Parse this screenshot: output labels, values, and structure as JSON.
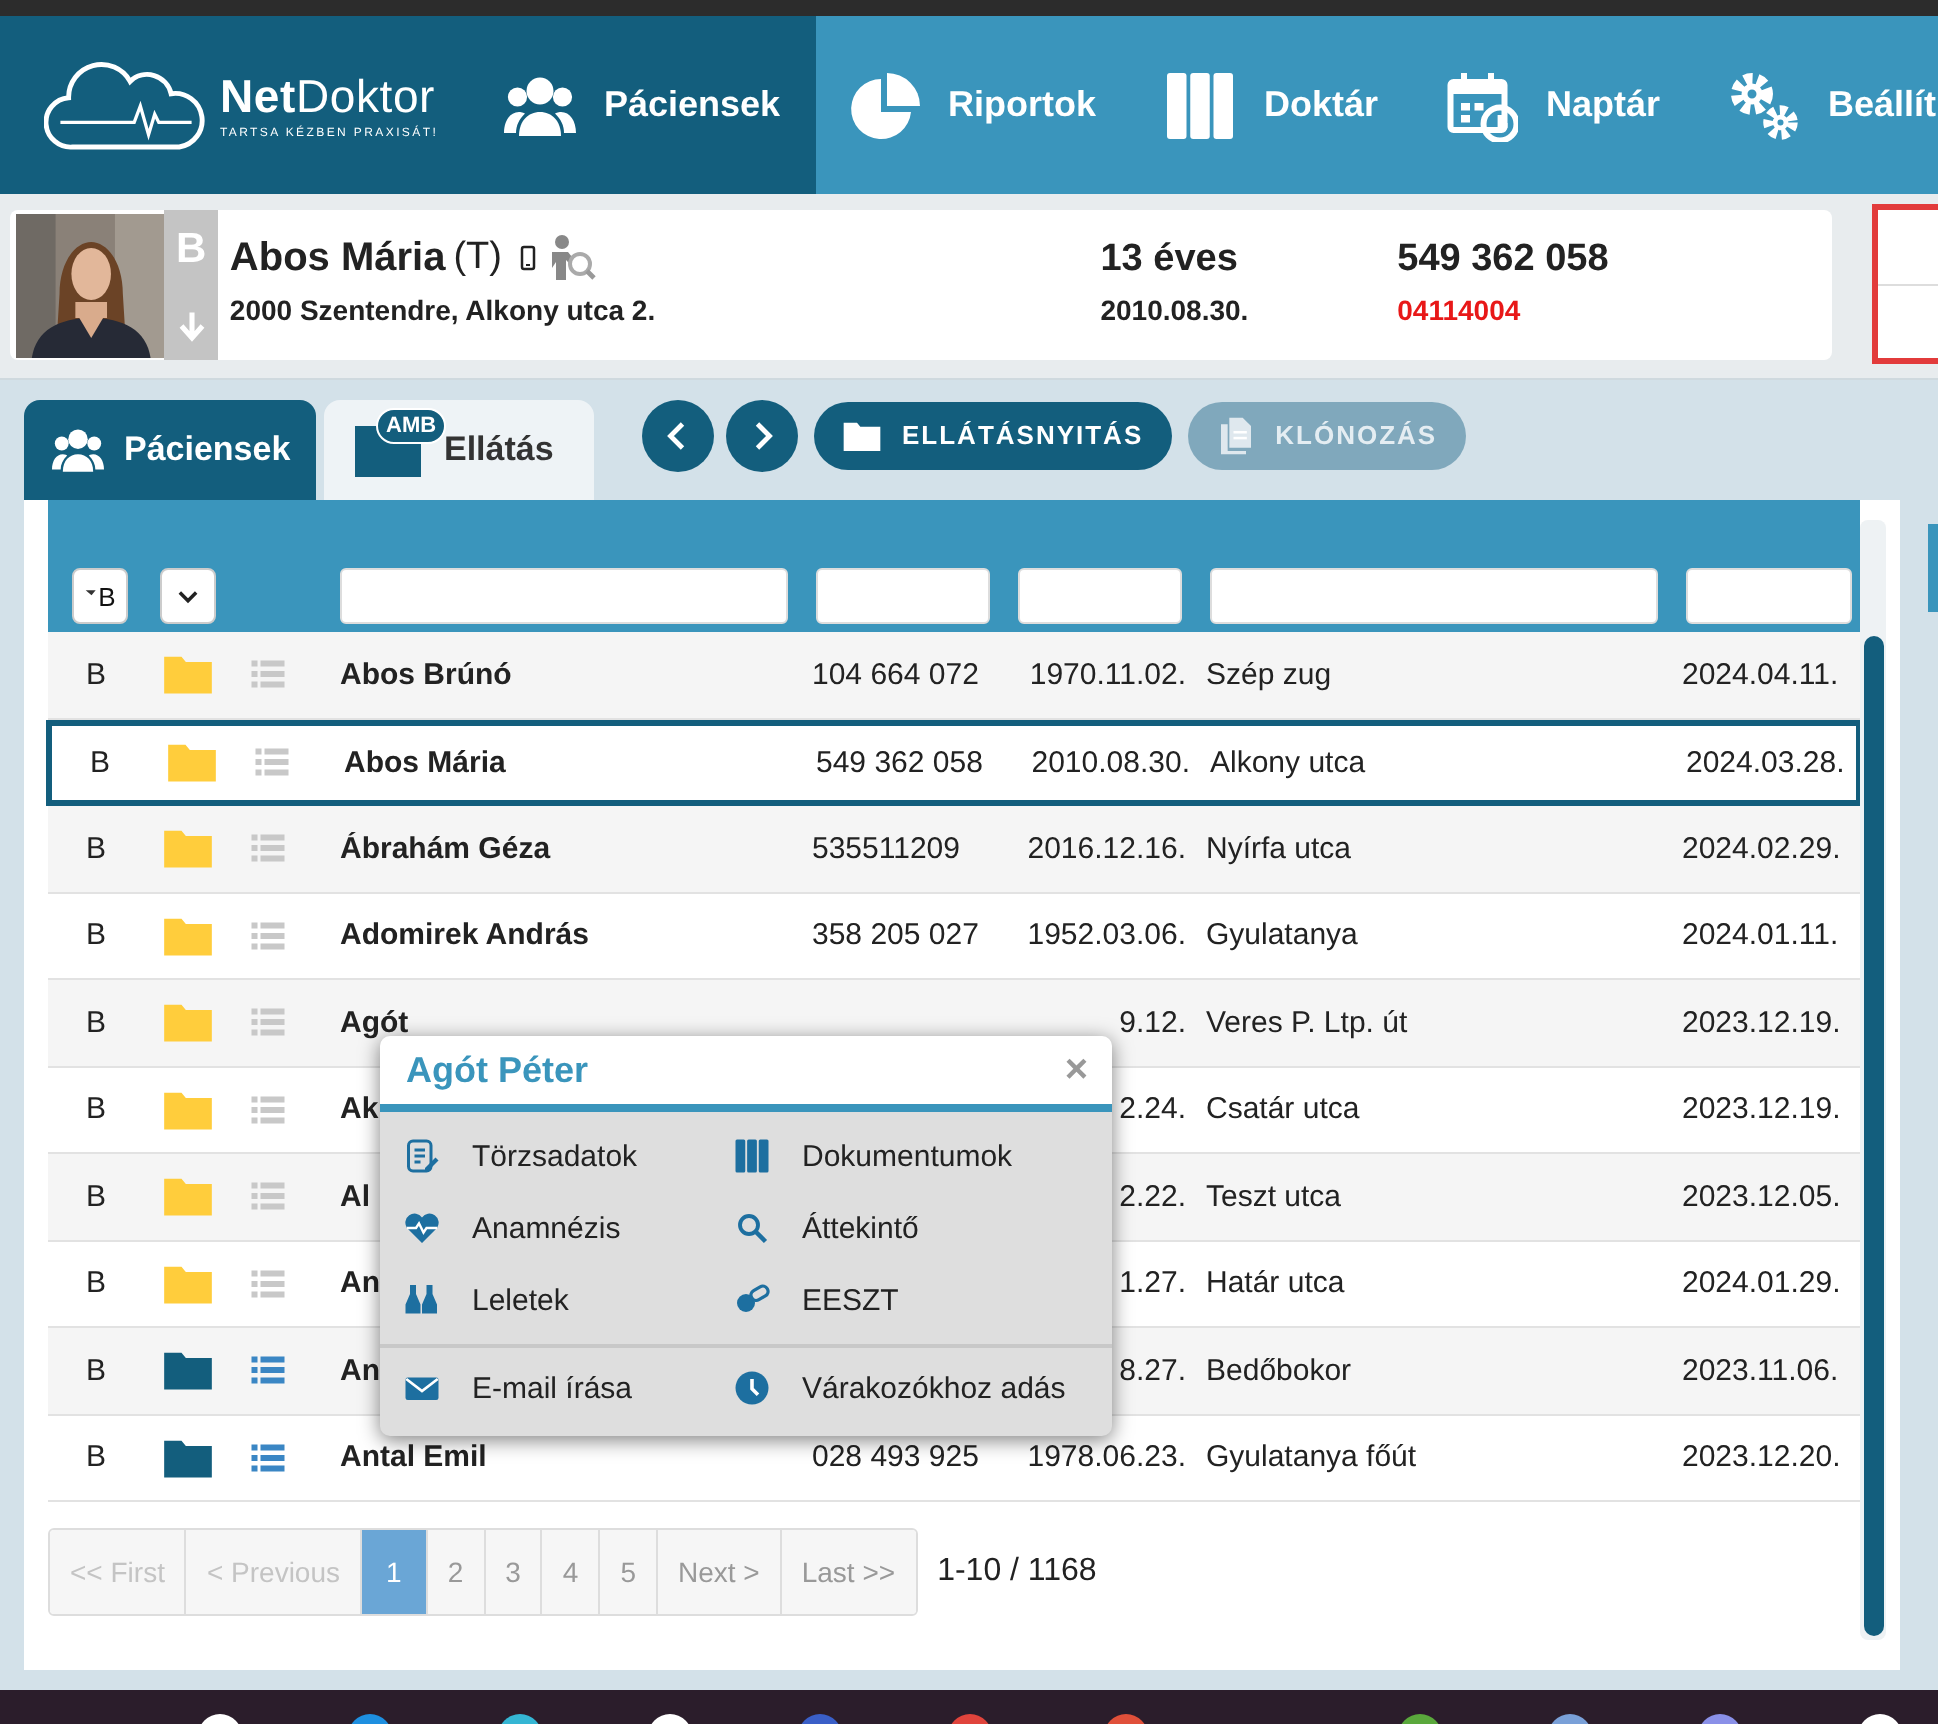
{
  "logo": {
    "name": "**Net**Doktor",
    "tagline": "TARTSA KÉZBEN PRAXISÁT!"
  },
  "nav": [
    {
      "label": "Páciensek",
      "selected": true
    },
    {
      "label": "Riportok",
      "selected": false
    },
    {
      "label": "Doktár",
      "selected": false
    },
    {
      "label": "Naptár",
      "selected": false
    },
    {
      "label": "Beállít",
      "selected": false
    }
  ],
  "patient": {
    "status": "B",
    "name": "Abos Mária",
    "suffix": "(T)",
    "address": "2000 Szentendre, Alkony utca 2.",
    "age": "13 éves",
    "birth": "2010.08.30.",
    "taj": "549 362 058",
    "code": "04114004"
  },
  "tabs": [
    {
      "label": "Páciensek",
      "selected": true
    },
    {
      "label": "Ellátás",
      "badge": "AMB",
      "selected": false
    }
  ],
  "toolbar": [
    {
      "kind": "prev"
    },
    {
      "kind": "next"
    },
    {
      "kind": "action",
      "label": "ELLÁTÁSNYITÁS",
      "disabled": false
    },
    {
      "kind": "action",
      "label": "KLÓNOZÁS",
      "disabled": true
    }
  ],
  "filters": {
    "status": "B"
  },
  "table": {
    "rows": [
      {
        "status": "B",
        "active": false,
        "name": "Abos Brúnó",
        "taj": "104 664 072",
        "birth": "1970.11.02.",
        "address": "Szép zug",
        "visit": "2024.04.11.",
        "selected": false
      },
      {
        "status": "B",
        "active": false,
        "name": "Abos Mária",
        "taj": "549 362 058",
        "birth": "2010.08.30.",
        "address": "Alkony utca",
        "visit": "2024.03.28.",
        "selected": true
      },
      {
        "status": "B",
        "active": false,
        "name": "Ábrahám Géza",
        "taj": "535511209",
        "birth": "2016.12.16.",
        "address": "Nyírfa utca",
        "visit": "2024.02.29.",
        "selected": false
      },
      {
        "status": "B",
        "active": false,
        "name": "Adomirek András",
        "taj": "358 205 027",
        "birth": "1952.03.06.",
        "address": "Gyulatanya",
        "visit": "2024.01.11.",
        "selected": false
      },
      {
        "status": "B",
        "active": false,
        "name": "Agót",
        "birth": "9.12.",
        "address": "Veres P. Ltp. út",
        "visit": "2023.12.19.",
        "selected": false
      },
      {
        "status": "B",
        "active": false,
        "name": "Ak",
        "birth": "2.24.",
        "address": "Csatár utca",
        "visit": "2023.12.19.",
        "selected": false
      },
      {
        "status": "B",
        "active": false,
        "name": "Al",
        "birth": "2.22.",
        "address": "Teszt utca",
        "visit": "2023.12.05.",
        "selected": false
      },
      {
        "status": "B",
        "active": false,
        "name": "An",
        "birth": "1.27.",
        "address": "Határ utca",
        "visit": "2024.01.29.",
        "selected": false
      },
      {
        "status": "B",
        "active": true,
        "name": "An",
        "birth": "8.27.",
        "address": "Bedőbokor",
        "visit": "2023.11.06.",
        "selected": false
      },
      {
        "status": "B",
        "active": true,
        "name": "Antal Emil",
        "taj": "028 493 925",
        "birth": "1978.06.23.",
        "address": "Gyulatanya főút",
        "visit": "2023.12.20.",
        "selected": false
      }
    ]
  },
  "popup": {
    "title": "Agót Péter",
    "close": "×",
    "groups": [
      {
        "items": [
          {
            "label": "Törzsadatok"
          },
          {
            "label": "Dokumentumok"
          },
          {
            "label": "Anamnézis"
          },
          {
            "label": "Áttekintő"
          },
          {
            "label": "Leletek"
          },
          {
            "label": "EESZT"
          }
        ]
      },
      {
        "items": [
          {
            "label": "E-mail írása"
          },
          {
            "label": "Várakozókhoz adás"
          }
        ]
      }
    ]
  },
  "pagination": {
    "pages": [
      {
        "label": "<< First",
        "selected": false,
        "disabled": true
      },
      {
        "label": "< Previous",
        "selected": false,
        "disabled": true
      },
      {
        "label": "1",
        "selected": true,
        "disabled": false
      },
      {
        "label": "2",
        "selected": false,
        "disabled": false
      },
      {
        "label": "3",
        "selected": false,
        "disabled": false
      },
      {
        "label": "4",
        "selected": false,
        "disabled": false
      },
      {
        "label": "5",
        "selected": false,
        "disabled": false
      },
      {
        "label": "Next >",
        "selected": false,
        "disabled": false
      },
      {
        "label": "Last >>",
        "selected": false,
        "disabled": false
      }
    ],
    "summary": "1-10 / 1168"
  }
}
